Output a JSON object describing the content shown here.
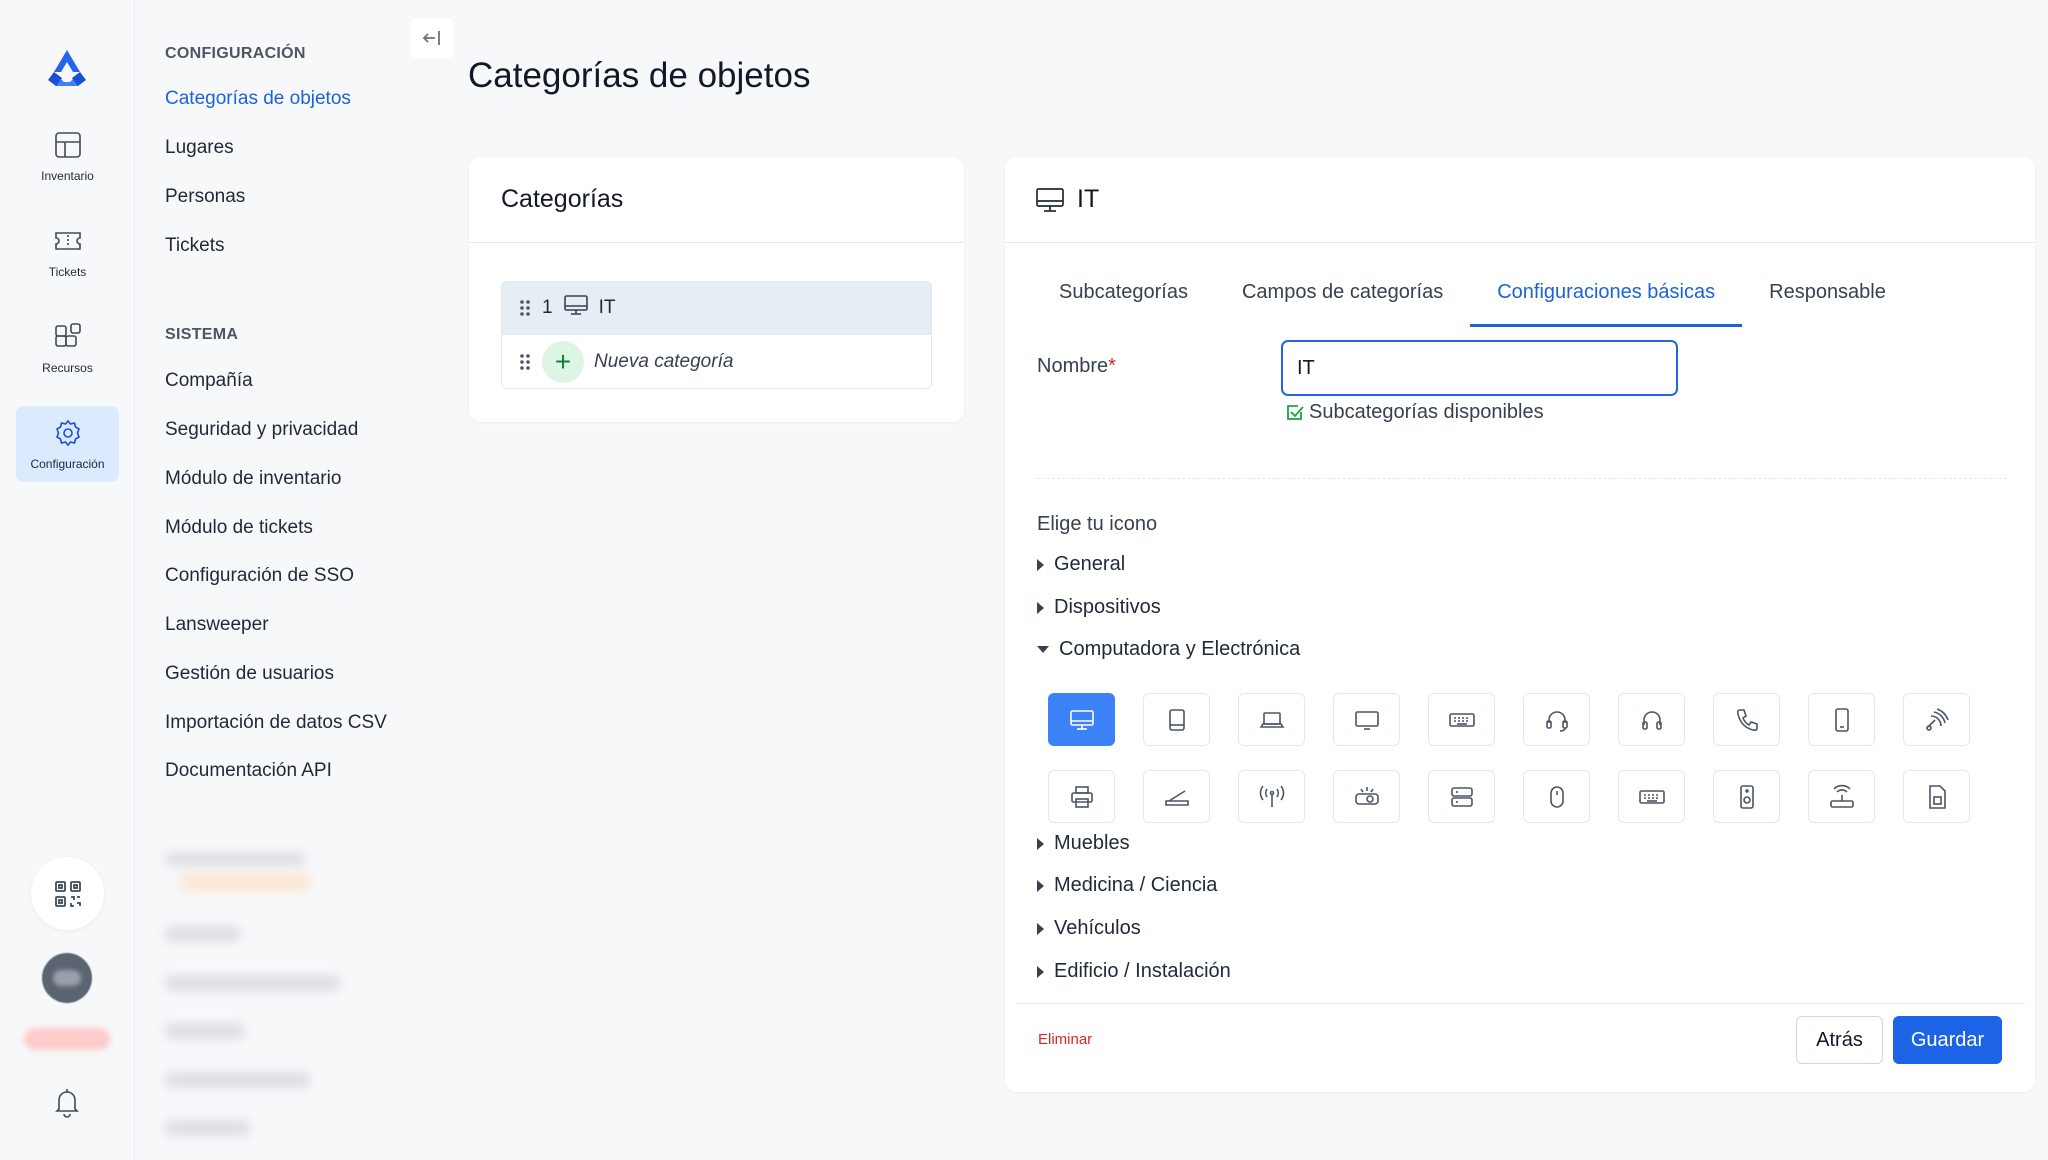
{
  "rail": {
    "items": [
      {
        "label": "Inventario",
        "icon": "inventory-grid-icon"
      },
      {
        "label": "Tickets",
        "icon": "ticket-icon"
      },
      {
        "label": "Recursos",
        "icon": "resources-icon"
      },
      {
        "label": "Configuración",
        "icon": "gear-icon",
        "active": true
      }
    ]
  },
  "nav": {
    "config_heading": "CONFIGURACIÓN",
    "config_items": [
      "Categorías de objetos",
      "Lugares",
      "Personas",
      "Tickets"
    ],
    "system_heading": "SISTEMA",
    "system_items": [
      "Compañía",
      "Seguridad y privacidad",
      "Módulo de inventario",
      "Módulo de tickets",
      "Configuración de SSO",
      "Lansweeper",
      "Gestión de usuarios",
      "Importación de datos CSV",
      "Documentación API"
    ]
  },
  "page": {
    "title": "Categorías de objetos"
  },
  "categories": {
    "title": "Categorías",
    "items": [
      {
        "index": "1",
        "name": "IT",
        "icon": "monitor-icon"
      }
    ],
    "new_label": "Nueva categoría"
  },
  "detail": {
    "title": "IT",
    "tabs": [
      "Subcategorías",
      "Campos de categorías",
      "Configuraciones básicas",
      "Responsable"
    ],
    "active_tab": "Configuraciones básicas",
    "name_label": "Nombre",
    "required_mark": "*",
    "name_value": "IT",
    "subcategories_label": "Subcategorías disponibles",
    "icon_section_title": "Elige tu icono",
    "groups": {
      "general": "General",
      "devices": "Dispositivos",
      "computer": "Computadora y Electrónica",
      "furniture": "Muebles",
      "medicine": "Medicina / Ciencia",
      "vehicles": "Vehículos",
      "building": "Edificio / Instalación"
    },
    "computer_icons": [
      "desktop-icon",
      "tablet-icon",
      "laptop-icon",
      "monitor-icon",
      "keyboard-icon",
      "headset-icon",
      "headphones-icon",
      "phone-icon",
      "smartphone-icon",
      "satellite-icon",
      "printer-icon",
      "scanner-icon",
      "antenna-icon",
      "projector-icon",
      "server-icon",
      "mouse-icon",
      "keyboard-alt-icon",
      "speaker-icon",
      "router-icon",
      "sim-card-icon"
    ],
    "selected_icon": "desktop-icon",
    "delete_label": "Eliminar",
    "back_label": "Atrás",
    "save_label": "Guardar"
  },
  "colors": {
    "accent": "#1d63d6",
    "save_button": "#1d63e6",
    "selected_icon_bg": "#3b82f6",
    "danger": "#dc2626"
  }
}
